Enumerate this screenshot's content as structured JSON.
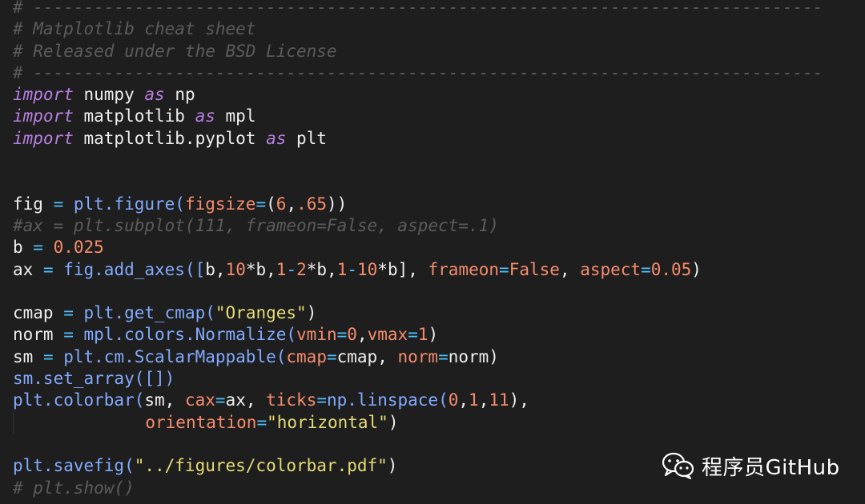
{
  "editor": {
    "lines": [
      [
        {
          "t": "# ------------------------------------------------------------------------------",
          "c": "comment"
        }
      ],
      [
        {
          "t": "# Matplotlib cheat sheet",
          "c": "comment"
        }
      ],
      [
        {
          "t": "# Released under the BSD License",
          "c": "comment"
        }
      ],
      [
        {
          "t": "# ------------------------------------------------------------------------------",
          "c": "comment"
        }
      ],
      [
        {
          "t": "import",
          "c": "keyword"
        },
        {
          "t": " numpy ",
          "c": "plain"
        },
        {
          "t": "as",
          "c": "keyword"
        },
        {
          "t": " np",
          "c": "plain"
        }
      ],
      [
        {
          "t": "import",
          "c": "keyword"
        },
        {
          "t": " matplotlib ",
          "c": "plain"
        },
        {
          "t": "as",
          "c": "keyword"
        },
        {
          "t": " mpl",
          "c": "plain"
        }
      ],
      [
        {
          "t": "import",
          "c": "keyword"
        },
        {
          "t": " matplotlib.pyplot ",
          "c": "plain"
        },
        {
          "t": "as",
          "c": "keyword"
        },
        {
          "t": " plt",
          "c": "plain"
        }
      ],
      [],
      [],
      [
        {
          "t": "fig ",
          "c": "plain"
        },
        {
          "t": "=",
          "c": "op"
        },
        {
          "t": " plt.figure(",
          "c": "func"
        },
        {
          "t": "figsize",
          "c": "param"
        },
        {
          "t": "=",
          "c": "op"
        },
        {
          "t": "(",
          "c": "punct"
        },
        {
          "t": "6",
          "c": "number"
        },
        {
          "t": ",",
          "c": "punct"
        },
        {
          "t": ".65",
          "c": "number"
        },
        {
          "t": "))",
          "c": "punct"
        }
      ],
      [
        {
          "t": "#ax = plt.subplot(111, frameon=False, aspect=.1)",
          "c": "comment"
        }
      ],
      [
        {
          "t": "b ",
          "c": "plain"
        },
        {
          "t": "=",
          "c": "op"
        },
        {
          "t": " ",
          "c": "plain"
        },
        {
          "t": "0.025",
          "c": "number"
        }
      ],
      [
        {
          "t": "ax ",
          "c": "plain"
        },
        {
          "t": "=",
          "c": "op"
        },
        {
          "t": " fig.add_axes([",
          "c": "func"
        },
        {
          "t": "b,",
          "c": "plain"
        },
        {
          "t": "10",
          "c": "number"
        },
        {
          "t": "*b,",
          "c": "plain"
        },
        {
          "t": "1",
          "c": "number"
        },
        {
          "t": "-",
          "c": "op"
        },
        {
          "t": "2",
          "c": "number"
        },
        {
          "t": "*b,",
          "c": "plain"
        },
        {
          "t": "1",
          "c": "number"
        },
        {
          "t": "-",
          "c": "op"
        },
        {
          "t": "10",
          "c": "number"
        },
        {
          "t": "*b], ",
          "c": "plain"
        },
        {
          "t": "frameon",
          "c": "param"
        },
        {
          "t": "=",
          "c": "op"
        },
        {
          "t": "False",
          "c": "const"
        },
        {
          "t": ", ",
          "c": "punct"
        },
        {
          "t": "aspect",
          "c": "param"
        },
        {
          "t": "=",
          "c": "op"
        },
        {
          "t": "0.05",
          "c": "number"
        },
        {
          "t": ")",
          "c": "punct"
        }
      ],
      [],
      [
        {
          "t": "cmap ",
          "c": "plain"
        },
        {
          "t": "=",
          "c": "op"
        },
        {
          "t": " plt.get_cmap(",
          "c": "func"
        },
        {
          "t": "\"Oranges\"",
          "c": "string"
        },
        {
          "t": ")",
          "c": "punct"
        }
      ],
      [
        {
          "t": "norm ",
          "c": "plain"
        },
        {
          "t": "=",
          "c": "op"
        },
        {
          "t": " mpl.colors.Normalize(",
          "c": "func"
        },
        {
          "t": "vmin",
          "c": "param"
        },
        {
          "t": "=",
          "c": "op"
        },
        {
          "t": "0",
          "c": "number"
        },
        {
          "t": ",",
          "c": "punct"
        },
        {
          "t": "vmax",
          "c": "param"
        },
        {
          "t": "=",
          "c": "op"
        },
        {
          "t": "1",
          "c": "number"
        },
        {
          "t": ")",
          "c": "punct"
        }
      ],
      [
        {
          "t": "sm ",
          "c": "plain"
        },
        {
          "t": "=",
          "c": "op"
        },
        {
          "t": " plt.cm.ScalarMappable(",
          "c": "func"
        },
        {
          "t": "cmap",
          "c": "param"
        },
        {
          "t": "=",
          "c": "op"
        },
        {
          "t": "cmap, ",
          "c": "plain"
        },
        {
          "t": "norm",
          "c": "param"
        },
        {
          "t": "=",
          "c": "op"
        },
        {
          "t": "norm)",
          "c": "plain"
        }
      ],
      [
        {
          "t": "sm.set_array([])",
          "c": "func"
        }
      ],
      [
        {
          "t": "plt.colorbar(",
          "c": "func"
        },
        {
          "t": "sm, ",
          "c": "plain"
        },
        {
          "t": "cax",
          "c": "param"
        },
        {
          "t": "=",
          "c": "op"
        },
        {
          "t": "ax, ",
          "c": "plain"
        },
        {
          "t": "ticks",
          "c": "param"
        },
        {
          "t": "=",
          "c": "op"
        },
        {
          "t": "np.linspace(",
          "c": "func"
        },
        {
          "t": "0",
          "c": "number"
        },
        {
          "t": ",",
          "c": "punct"
        },
        {
          "t": "1",
          "c": "number"
        },
        {
          "t": ",",
          "c": "punct"
        },
        {
          "t": "11",
          "c": "number"
        },
        {
          "t": "),",
          "c": "punct"
        }
      ],
      [
        {
          "t": "             ",
          "c": "indent"
        },
        {
          "t": "orientation",
          "c": "param"
        },
        {
          "t": "=",
          "c": "op"
        },
        {
          "t": "\"horizontal\"",
          "c": "string"
        },
        {
          "t": ")",
          "c": "punct"
        }
      ],
      [],
      [
        {
          "t": "plt.savefig(",
          "c": "func"
        },
        {
          "t": "\"../figures/colorbar.pdf\"",
          "c": "string"
        },
        {
          "t": ")",
          "c": "punct"
        }
      ],
      [
        {
          "t": "# plt.show()",
          "c": "comment"
        }
      ]
    ]
  },
  "watermark": {
    "icon": "wechat-icon",
    "label": "程序员GitHub"
  },
  "colors": {
    "background": "#1e1e1e",
    "comment": "#5b5b5b",
    "keyword": "#b77ee0",
    "function": "#82aaff",
    "parameter": "#f78c6c",
    "string": "#e6db74",
    "operator": "#4fc1ff"
  }
}
